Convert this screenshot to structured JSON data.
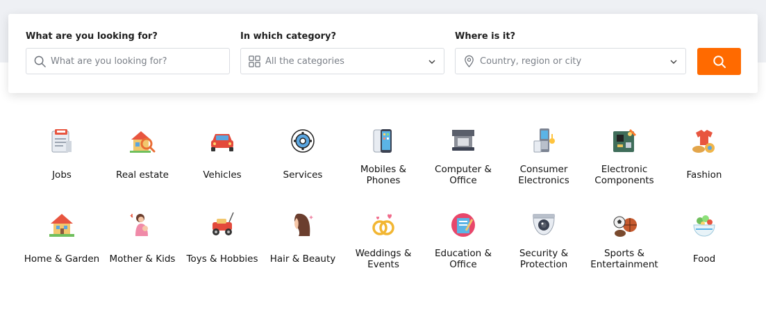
{
  "search": {
    "what_label": "What are you looking for?",
    "what_placeholder": "What are you looking for?",
    "category_label": "In which category?",
    "category_value": "All the categories",
    "where_label": "Where is it?",
    "where_placeholder": "Country, region or city",
    "accent": "#ff6a00"
  },
  "categories_row1": [
    {
      "label": "Jobs",
      "icon": "job-newspaper-icon"
    },
    {
      "label": "Real estate",
      "icon": "house-search-icon"
    },
    {
      "label": "Vehicles",
      "icon": "car-icon"
    },
    {
      "label": "Services",
      "icon": "gear-icon"
    },
    {
      "label": "Mobiles & Phones",
      "icon": "smartphone-icon"
    },
    {
      "label": "Computer & Office",
      "icon": "laptop-icon"
    },
    {
      "label": "Consumer Electronics",
      "icon": "appliances-icon"
    },
    {
      "label": "Electronic Components",
      "icon": "circuit-board-icon"
    },
    {
      "label": "Fashion",
      "icon": "clothes-icon"
    }
  ],
  "categories_row2": [
    {
      "label": "Home & Garden",
      "icon": "home-garden-icon"
    },
    {
      "label": "Mother & Kids",
      "icon": "mother-child-icon"
    },
    {
      "label": "Toys & Hobbies",
      "icon": "toy-car-icon"
    },
    {
      "label": "Hair & Beauty",
      "icon": "hair-icon"
    },
    {
      "label": "Weddings & Events",
      "icon": "wedding-rings-icon"
    },
    {
      "label": "Education & Office",
      "icon": "book-icon"
    },
    {
      "label": "Security & Protection",
      "icon": "security-camera-icon"
    },
    {
      "label": "Sports & Entertainment",
      "icon": "sports-balls-icon"
    },
    {
      "label": "Food",
      "icon": "salad-bowl-icon"
    }
  ]
}
